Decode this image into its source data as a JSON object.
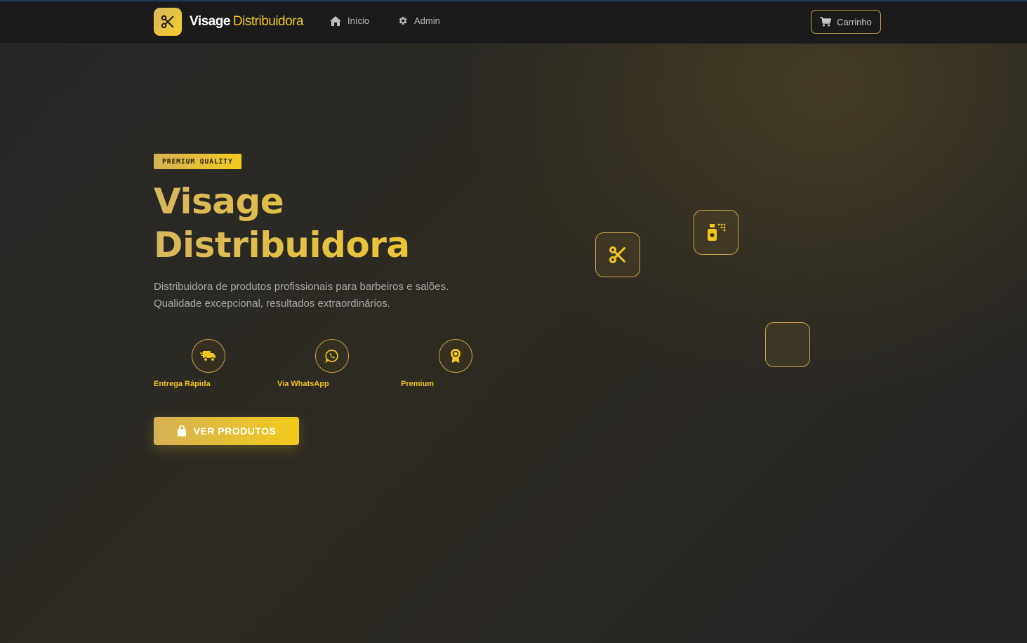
{
  "brand": {
    "name": "Visage",
    "accent": "Distribuidora",
    "logo_icon": "scissors-icon"
  },
  "nav": {
    "links": [
      {
        "label": "Início",
        "icon": "home-icon"
      },
      {
        "label": "Admin",
        "icon": "gear-icon"
      }
    ],
    "cart_label": "Carrinho"
  },
  "hero": {
    "badge": "PREMIUM QUALITY",
    "title_line1": "Visage",
    "title_line2": "Distribuidora",
    "description_line1": "Distribuidora de produtos profissionais para barbeiros e salões.",
    "description_line2": "Qualidade excepcional, resultados extraordinários.",
    "features": [
      {
        "label": "Entrega Rápida",
        "icon": "truck-icon"
      },
      {
        "label": "Via WhatsApp",
        "icon": "whatsapp-icon"
      },
      {
        "label": "Premium",
        "icon": "award-icon"
      }
    ],
    "cta_label": "VER PRODUTOS",
    "cta_icon": "shopping-bag-icon"
  },
  "floating_cards": [
    "scissors-icon",
    "spray-bottle-icon",
    "blank"
  ],
  "colors": {
    "accent": "#f2c81e",
    "gold": "#d6b054",
    "background": "#252525",
    "navbar": "#1b1b1b"
  }
}
